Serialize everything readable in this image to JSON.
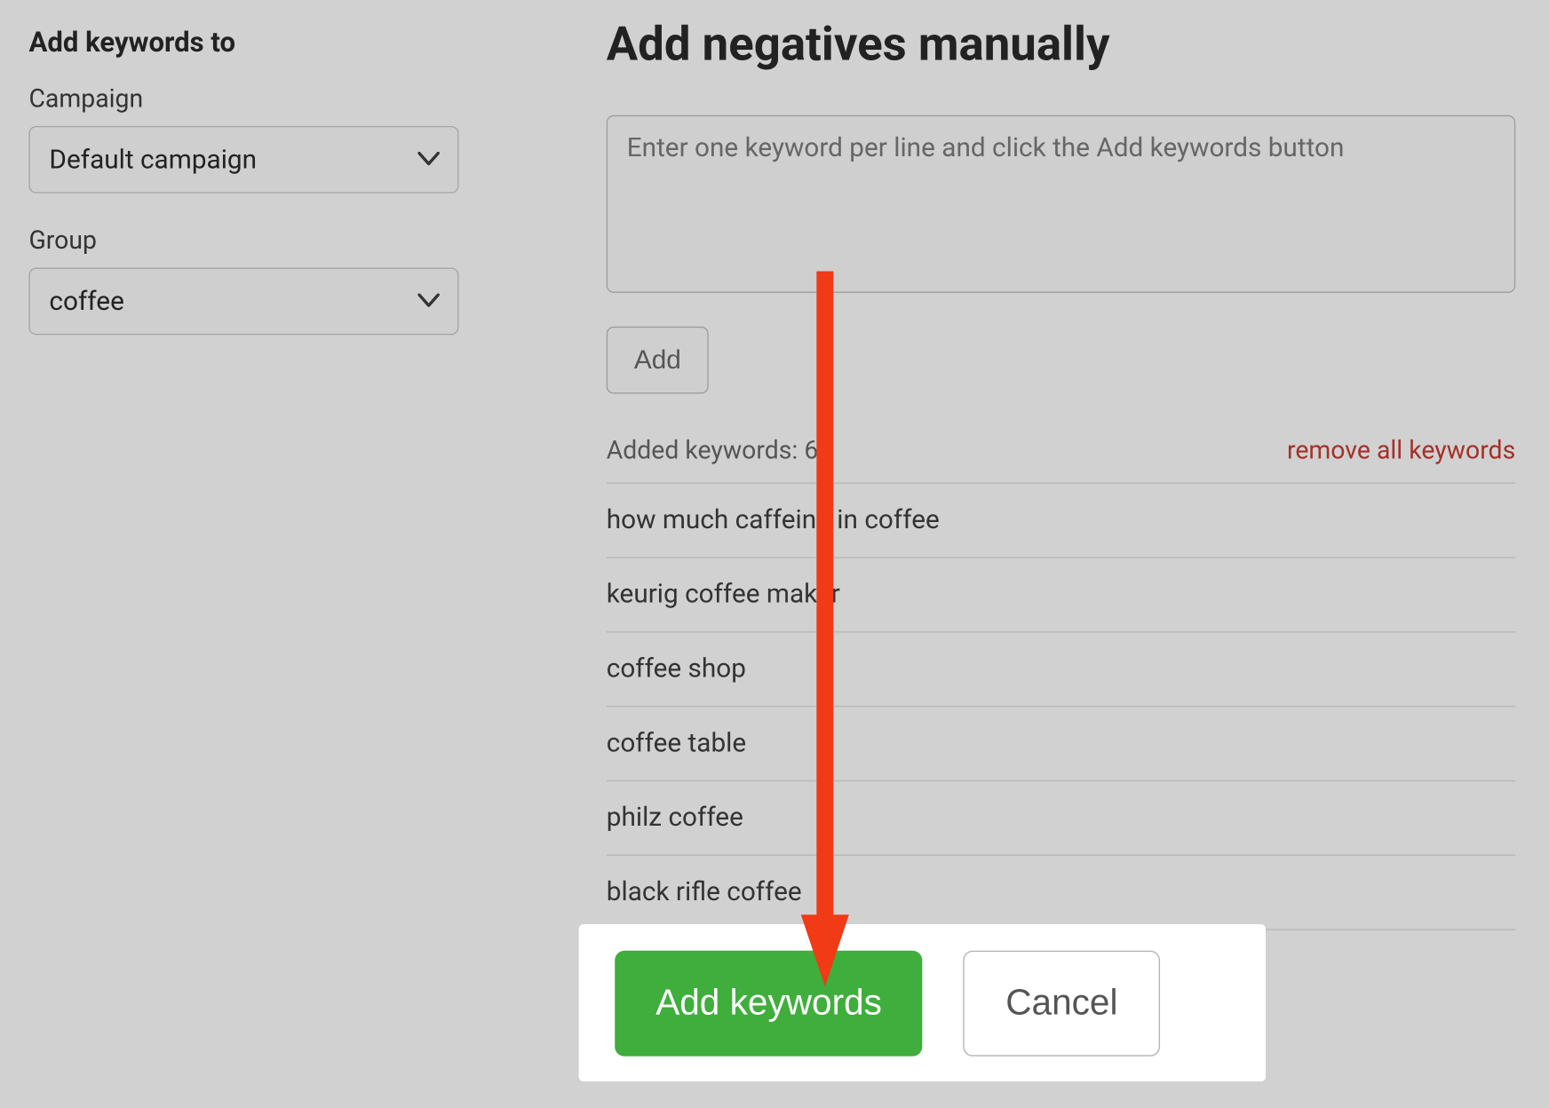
{
  "sidebar": {
    "title": "Add keywords to",
    "campaign_label": "Campaign",
    "campaign_value": "Default campaign",
    "group_label": "Group",
    "group_value": "coffee"
  },
  "main": {
    "heading": "Add negatives manually",
    "textarea_placeholder": "Enter one keyword per line and click the Add keywords button",
    "add_btn": "Add",
    "added_label": "Added keywords:",
    "added_count": "6",
    "remove_all_label": "remove all keywords",
    "keywords": [
      "how much caffeine in coffee",
      "keurig coffee maker",
      "coffee shop",
      "coffee table",
      "philz coffee",
      "black rifle coffee"
    ]
  },
  "actions": {
    "primary_label": "Add keywords",
    "secondary_label": "Cancel"
  },
  "colors": {
    "primary_green": "#3fae3c",
    "danger_red": "#a53028",
    "annotation_red": "#f13a16"
  }
}
